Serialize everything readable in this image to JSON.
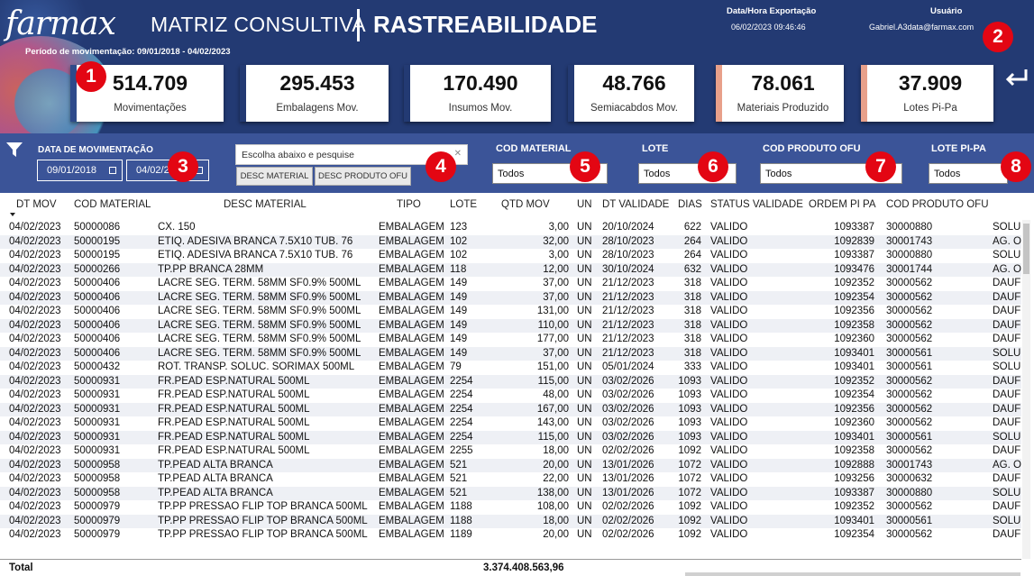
{
  "header": {
    "logo": "farmax",
    "title_part1": "MATRIZ CONSULTIVA",
    "title_part2": "RASTREABILIDADE",
    "periodo": "Período de movimentação: 09/01/2018 - 04/02/2023",
    "export_label": "Data/Hora Exportação",
    "export_value": "06/02/2023 09:46:46",
    "user_label": "Usuário",
    "user_value": "Gabriel.A3data@farmax.com"
  },
  "kpis": [
    {
      "value": "514.709",
      "label": "Movimentações",
      "color": "#2e4a8a"
    },
    {
      "value": "295.453",
      "label": "Embalagens Mov.",
      "color": "#233a73"
    },
    {
      "value": "170.490",
      "label": "Insumos Mov.",
      "color": "#233a73"
    },
    {
      "value": "48.766",
      "label": "Semiacabdos Mov.",
      "color": "#233a73"
    },
    {
      "value": "78.061",
      "label": "Materiais Produzido",
      "color": "#e8a08a"
    },
    {
      "value": "37.909",
      "label": "Lotes Pi-Pa",
      "color": "#e8a08a"
    }
  ],
  "badges": [
    "1",
    "2",
    "3",
    "4",
    "5",
    "6",
    "7",
    "8"
  ],
  "filters": {
    "date_label": "DATA DE MOVIMENTAÇÃO",
    "date_start": "09/01/2018",
    "date_end": "04/02/2023",
    "search_placeholder": "Escolha abaixo e pesquise",
    "btn_desc_material": "DESC MATERIAL",
    "btn_desc_produto": "DESC PRODUTO OFU",
    "cod_material_label": "COD MATERIAL",
    "cod_material_value": "Todos",
    "lote_label": "LOTE",
    "lote_value": "Todos",
    "cod_produto_label": "COD PRODUTO OFU",
    "cod_produto_value": "Todos",
    "lote_pipa_label": "LOTE PI-PA",
    "lote_pipa_value": "Todos"
  },
  "table": {
    "columns": [
      "DT MOV",
      "COD MATERIAL",
      "DESC MATERIAL",
      "TIPO",
      "LOTE",
      "QTD MOV",
      "UN",
      "DT VALIDADE",
      "DIAS",
      "STATUS VALIDADE",
      "ORDEM PI PA",
      "COD PRODUTO OFU"
    ],
    "rows": [
      [
        "04/02/2023",
        "50000086",
        "CX. 150",
        "EMBALAGEM",
        "123",
        "3,00",
        "UN",
        "20/10/2024",
        "622",
        "VALIDO",
        "1093387",
        "30000880",
        "SOLUC"
      ],
      [
        "04/02/2023",
        "50000195",
        "ETIQ. ADESIVA BRANCA 7.5X10 TUB. 76",
        "EMBALAGEM",
        "102",
        "32,00",
        "UN",
        "28/10/2023",
        "264",
        "VALIDO",
        "1092839",
        "30001743",
        "AG. O>"
      ],
      [
        "04/02/2023",
        "50000195",
        "ETIQ. ADESIVA BRANCA 7.5X10 TUB. 76",
        "EMBALAGEM",
        "102",
        "3,00",
        "UN",
        "28/10/2023",
        "264",
        "VALIDO",
        "1093387",
        "30000880",
        "SOLUC"
      ],
      [
        "04/02/2023",
        "50000266",
        "TP.PP BRANCA 28MM",
        "EMBALAGEM",
        "118",
        "12,00",
        "UN",
        "30/10/2024",
        "632",
        "VALIDO",
        "1093476",
        "30001744",
        "AG. O>"
      ],
      [
        "04/02/2023",
        "50000406",
        "LACRE SEG. TERM. 58MM SF0.9% 500ML",
        "EMBALAGEM",
        "149",
        "37,00",
        "UN",
        "21/12/2023",
        "318",
        "VALIDO",
        "1092352",
        "30000562",
        "DAUF"
      ],
      [
        "04/02/2023",
        "50000406",
        "LACRE SEG. TERM. 58MM SF0.9% 500ML",
        "EMBALAGEM",
        "149",
        "37,00",
        "UN",
        "21/12/2023",
        "318",
        "VALIDO",
        "1092354",
        "30000562",
        "DAUF"
      ],
      [
        "04/02/2023",
        "50000406",
        "LACRE SEG. TERM. 58MM SF0.9% 500ML",
        "EMBALAGEM",
        "149",
        "131,00",
        "UN",
        "21/12/2023",
        "318",
        "VALIDO",
        "1092356",
        "30000562",
        "DAUF"
      ],
      [
        "04/02/2023",
        "50000406",
        "LACRE SEG. TERM. 58MM SF0.9% 500ML",
        "EMBALAGEM",
        "149",
        "110,00",
        "UN",
        "21/12/2023",
        "318",
        "VALIDO",
        "1092358",
        "30000562",
        "DAUF"
      ],
      [
        "04/02/2023",
        "50000406",
        "LACRE SEG. TERM. 58MM SF0.9% 500ML",
        "EMBALAGEM",
        "149",
        "177,00",
        "UN",
        "21/12/2023",
        "318",
        "VALIDO",
        "1092360",
        "30000562",
        "DAUF"
      ],
      [
        "04/02/2023",
        "50000406",
        "LACRE SEG. TERM. 58MM SF0.9% 500ML",
        "EMBALAGEM",
        "149",
        "37,00",
        "UN",
        "21/12/2023",
        "318",
        "VALIDO",
        "1093401",
        "30000561",
        "SOLUC"
      ],
      [
        "04/02/2023",
        "50000432",
        "ROT. TRANSP. SOLUC. SORIMAX 500ML",
        "EMBALAGEM",
        "79",
        "151,00",
        "UN",
        "05/01/2024",
        "333",
        "VALIDO",
        "1093401",
        "30000561",
        "SOLUC"
      ],
      [
        "04/02/2023",
        "50000931",
        "FR.PEAD ESP.NATURAL 500ML",
        "EMBALAGEM",
        "2254",
        "115,00",
        "UN",
        "03/02/2026",
        "1093",
        "VALIDO",
        "1092352",
        "30000562",
        "DAUF"
      ],
      [
        "04/02/2023",
        "50000931",
        "FR.PEAD ESP.NATURAL 500ML",
        "EMBALAGEM",
        "2254",
        "48,00",
        "UN",
        "03/02/2026",
        "1093",
        "VALIDO",
        "1092354",
        "30000562",
        "DAUF"
      ],
      [
        "04/02/2023",
        "50000931",
        "FR.PEAD ESP.NATURAL 500ML",
        "EMBALAGEM",
        "2254",
        "167,00",
        "UN",
        "03/02/2026",
        "1093",
        "VALIDO",
        "1092356",
        "30000562",
        "DAUF"
      ],
      [
        "04/02/2023",
        "50000931",
        "FR.PEAD ESP.NATURAL 500ML",
        "EMBALAGEM",
        "2254",
        "143,00",
        "UN",
        "03/02/2026",
        "1093",
        "VALIDO",
        "1092360",
        "30000562",
        "DAUF"
      ],
      [
        "04/02/2023",
        "50000931",
        "FR.PEAD ESP.NATURAL 500ML",
        "EMBALAGEM",
        "2254",
        "115,00",
        "UN",
        "03/02/2026",
        "1093",
        "VALIDO",
        "1093401",
        "30000561",
        "SOLUC"
      ],
      [
        "04/02/2023",
        "50000931",
        "FR.PEAD ESP.NATURAL 500ML",
        "EMBALAGEM",
        "2255",
        "18,00",
        "UN",
        "02/02/2026",
        "1092",
        "VALIDO",
        "1092358",
        "30000562",
        "DAUF"
      ],
      [
        "04/02/2023",
        "50000958",
        "TP.PEAD ALTA BRANCA",
        "EMBALAGEM",
        "521",
        "20,00",
        "UN",
        "13/01/2026",
        "1072",
        "VALIDO",
        "1092888",
        "30001743",
        "AG. O>"
      ],
      [
        "04/02/2023",
        "50000958",
        "TP.PEAD ALTA BRANCA",
        "EMBALAGEM",
        "521",
        "22,00",
        "UN",
        "13/01/2026",
        "1072",
        "VALIDO",
        "1093256",
        "30000632",
        "DAUF"
      ],
      [
        "04/02/2023",
        "50000958",
        "TP.PEAD ALTA BRANCA",
        "EMBALAGEM",
        "521",
        "138,00",
        "UN",
        "13/01/2026",
        "1072",
        "VALIDO",
        "1093387",
        "30000880",
        "SOLUC"
      ],
      [
        "04/02/2023",
        "50000979",
        "TP.PP PRESSAO FLIP TOP BRANCA 500ML",
        "EMBALAGEM",
        "1188",
        "108,00",
        "UN",
        "02/02/2026",
        "1092",
        "VALIDO",
        "1092352",
        "30000562",
        "DAUF"
      ],
      [
        "04/02/2023",
        "50000979",
        "TP.PP PRESSAO FLIP TOP BRANCA 500ML",
        "EMBALAGEM",
        "1188",
        "18,00",
        "UN",
        "02/02/2026",
        "1092",
        "VALIDO",
        "1093401",
        "30000561",
        "SOLUC"
      ],
      [
        "04/02/2023",
        "50000979",
        "TP.PP PRESSAO FLIP TOP BRANCA 500ML",
        "EMBALAGEM",
        "1189",
        "20,00",
        "UN",
        "02/02/2026",
        "1092",
        "VALIDO",
        "1092354",
        "30000562",
        "DAUF"
      ]
    ],
    "total_label": "Total",
    "total_value": "3.374.408.563,96"
  }
}
